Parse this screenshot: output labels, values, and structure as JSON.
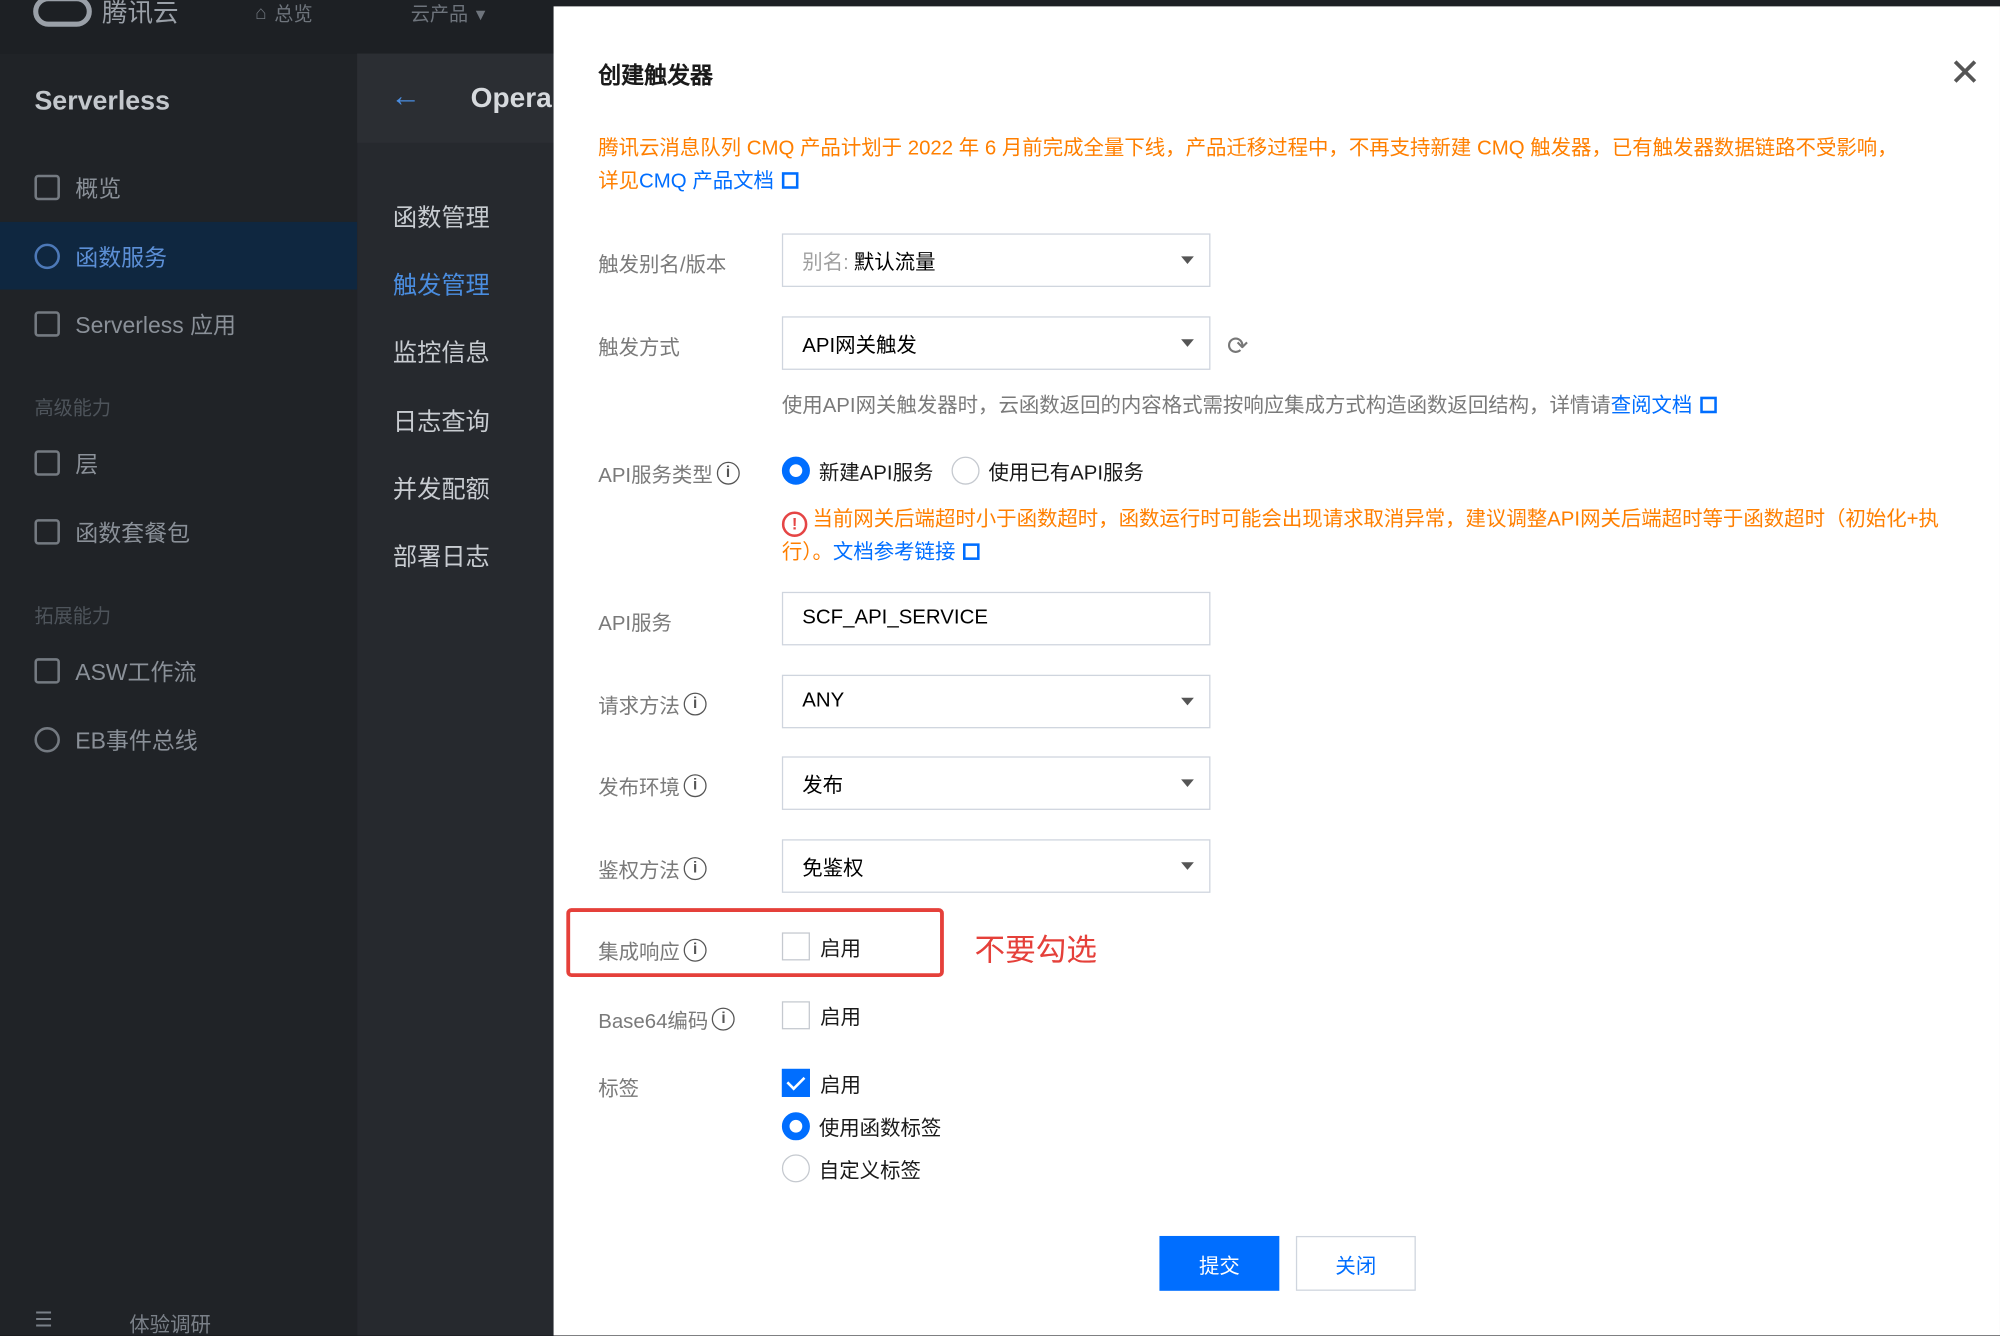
{
  "console": {
    "brand": "腾讯云",
    "top_nav": [
      "总览",
      "云产品"
    ],
    "sidebar_title": "Serverless",
    "sidebar_items": [
      "概览",
      "函数服务",
      "Serverless 应用"
    ],
    "group_advanced": "高级能力",
    "advanced_items": [
      "层",
      "函数套餐包"
    ],
    "group_extension": "拓展能力",
    "extension_items": [
      "ASW工作流",
      "EB事件总线"
    ],
    "footer_link": "体验调研",
    "panel_title": "Opera",
    "panel_items": [
      "函数管理",
      "触发管理",
      "监控信息",
      "日志查询",
      "并发配额",
      "部署日志"
    ]
  },
  "modal": {
    "title": "创建触发器",
    "notice": "腾讯云消息队列 CMQ 产品计划于 2022 年 6 月前完成全量下线，产品迁移过程中，不再支持新建 CMQ 触发器，已有触发器数据链路不受影响，",
    "notice_prefix": "详见",
    "notice_link": "CMQ 产品文档",
    "labels": {
      "alias": "触发别名/版本",
      "method": "触发方式",
      "api_type": "API服务类型",
      "api_service": "API服务",
      "request_method": "请求方法",
      "env": "发布环境",
      "auth": "鉴权方法",
      "integration": "集成响应",
      "base64": "Base64编码",
      "tags": "标签"
    },
    "alias_prefix": "别名:",
    "alias_value": "默认流量",
    "trigger_method": "API网关触发",
    "help_text": "使用API网关触发器时，云函数返回的内容格式需按响应集成方式构造函数返回结构，详情请",
    "help_link": "查阅文档",
    "api_type_options": [
      "新建API服务",
      "使用已有API服务"
    ],
    "warning": "当前网关后端超时小于函数超时，函数运行时可能会出现请求取消异常，建议调整API网关后端超时等于函数超时（初始化+执行）。",
    "warning_link": "文档参考链接",
    "api_service_value": "SCF_API_SERVICE",
    "request_method_value": "ANY",
    "env_value": "发布",
    "auth_value": "免鉴权",
    "enable_label": "启用",
    "tag_options": [
      "使用函数标签",
      "自定义标签"
    ],
    "annotation": "不要勾选",
    "submit": "提交",
    "close": "关闭"
  },
  "state": {
    "api_type_selected": "新建API服务",
    "integration_checked": false,
    "base64_checked": false,
    "tags_checked": true,
    "tag_option_selected": "使用函数标签"
  },
  "colors": {
    "primary": "#006eff",
    "warning": "#ff7f00",
    "annotation": "#e5403a"
  }
}
